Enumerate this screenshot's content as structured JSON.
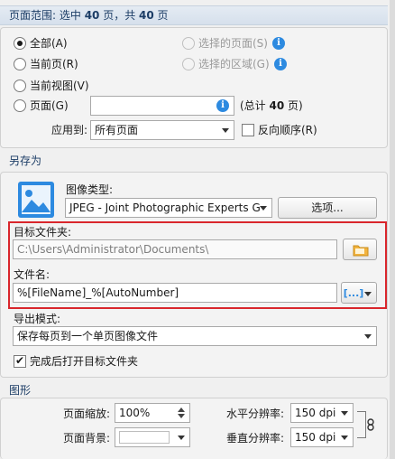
{
  "page_range": {
    "header_prefix": "页面范围: 选中 ",
    "header_selected": "40",
    "header_mid": " 页，共 ",
    "header_total": "40",
    "header_suffix": " 页",
    "all": "全部(A)",
    "current_page": "当前页(R)",
    "current_view": "当前视图(V)",
    "pages": "页面(G)",
    "selected_pages": "选择的页面(S)",
    "selected_area": "选择的区域(G)",
    "total_prefix": "(总计 ",
    "total_count": "40",
    "total_suffix": " 页)",
    "apply_to_label": "应用到:",
    "apply_to_value": "所有页面",
    "reverse_order": "反向顺序(R)",
    "selected_option": "all"
  },
  "save_as": {
    "header": "另存为",
    "image_type_label": "图像类型:",
    "image_type_value": "JPEG - Joint Photographic Experts G",
    "options_button": "选项...",
    "target_folder_label": "目标文件夹:",
    "target_folder_value": "C:\\Users\\Administrator\\Documents\\",
    "file_name_label": "文件名:",
    "file_name_value": "%[FileName]_%[AutoNumber]",
    "macro_button_glyph": "[...]",
    "export_mode_label": "导出模式:",
    "export_mode_value": "保存每页到一个单页图像文件",
    "open_folder_after": "完成后打开目标文件夹",
    "open_folder_checked": true
  },
  "graphics": {
    "header": "图形",
    "page_zoom_label": "页面缩放:",
    "page_zoom_value": "100%",
    "page_background_label": "页面背景:",
    "page_background_color": "#ffffff",
    "horizontal_dpi_label": "水平分辨率:",
    "horizontal_dpi_value": "150 dpi",
    "vertical_dpi_label": "垂直分辨率:",
    "vertical_dpi_value": "150 dpi"
  },
  "colors": {
    "header_text": "#1c3d66",
    "info_icon": "#2d8ae0",
    "highlight_border": "#d9262c",
    "image_icon": "#2d8ae0"
  }
}
